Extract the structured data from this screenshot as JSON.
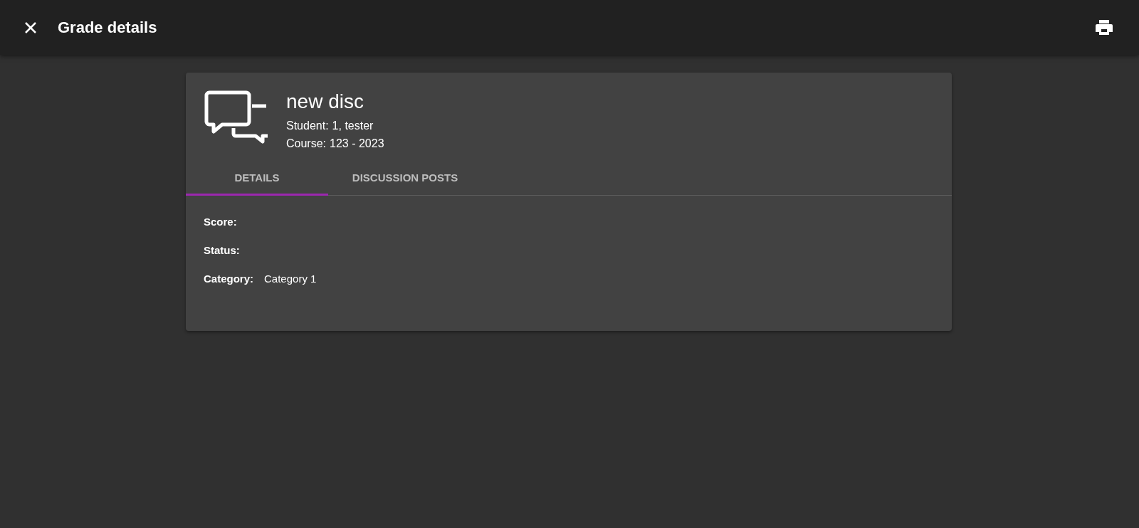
{
  "toolbar": {
    "title": "Grade details"
  },
  "card": {
    "title": "new disc",
    "meta": [
      {
        "label": "Student:",
        "value": "1, tester"
      },
      {
        "label": "Course:",
        "value": "123 - 2023"
      }
    ],
    "tabs": [
      {
        "label": "DETAILS",
        "selected": true
      },
      {
        "label": "DISCUSSION POSTS",
        "selected": false
      }
    ],
    "fields": [
      {
        "label": "Score:"
      },
      {
        "label": "Status:"
      },
      {
        "label": "Category:",
        "value": "Category 1"
      }
    ]
  }
}
